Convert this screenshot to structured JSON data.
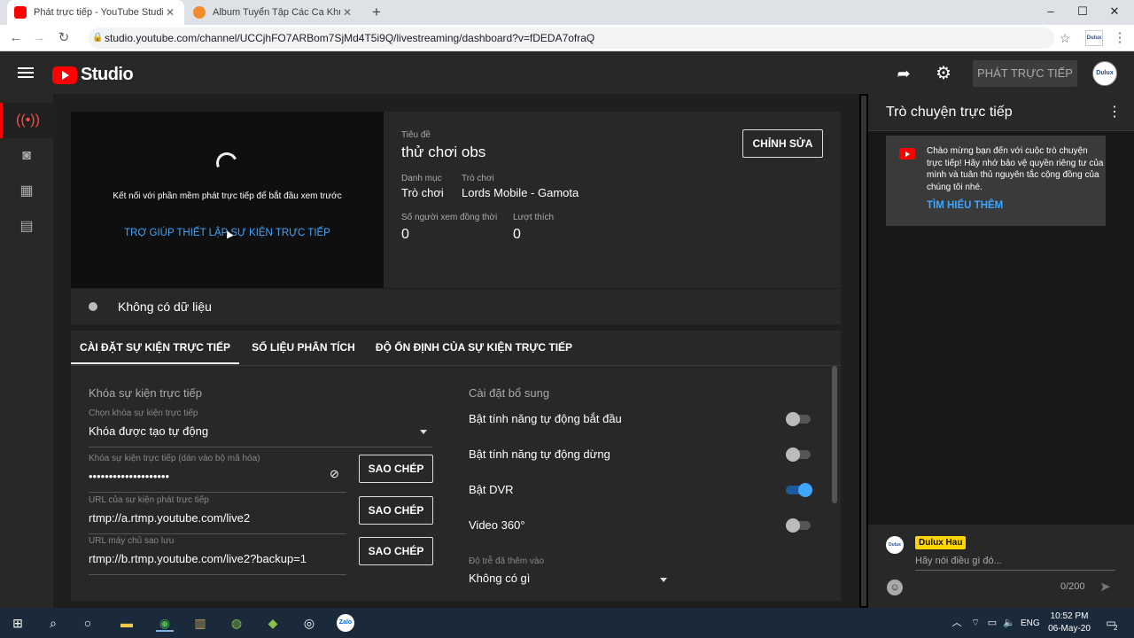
{
  "browser": {
    "tabs": [
      {
        "title": "Phát trực tiếp - YouTube Studio",
        "active": true
      },
      {
        "title": "Album Tuyển Tập Các Ca Khúc Nổ",
        "active": false
      }
    ],
    "new_tab": "+",
    "url": "studio.youtube.com/channel/UCCjhFO7ARBom7SjMd4T5i9Q/livestreaming/dashboard?v=fDEDA7ofraQ"
  },
  "header": {
    "logo_text": "Studio",
    "go_live_label": "PHÁT TRỰC TIẾP",
    "avatar_text": "Dulux"
  },
  "preview": {
    "message": "Kết nối với phần mềm phát trực tiếp để bắt đầu xem trước",
    "help_link": "TRỢ GIÚP THIẾT LẬP SỰ KIỆN TRỰC TIẾP"
  },
  "info": {
    "title_label": "Tiêu đề",
    "title_value": "thử chơi obs",
    "category_label": "Danh mục",
    "category_value": "Trò chơi",
    "game_label": "Trò chơi",
    "game_value": "Lords Mobile - Gamota",
    "viewers_label": "Số người xem đồng thời",
    "viewers_value": "0",
    "likes_label": "Lượt thích",
    "likes_value": "0",
    "edit_label": "CHỈNH SỬA"
  },
  "status": {
    "text": "Không có dữ liệu"
  },
  "settings": {
    "tabs": [
      {
        "label": "CÀI ĐẶT SỰ KIỆN TRỰC TIẾP",
        "active": true
      },
      {
        "label": "SỐ LIỆU PHÂN TÍCH",
        "active": false
      },
      {
        "label": "ĐỘ ỔN ĐỊNH CỦA SỰ KIỆN TRỰC TIẾP",
        "active": false
      }
    ],
    "stream_key_heading": "Khóa sự kiện trực tiếp",
    "select_key_label": "Chọn khóa sự kiện trực tiếp",
    "select_key_value": "Khóa được tạo tự động",
    "key_label": "Khóa sự kiện trực tiếp (dán vào bộ mã hóa)",
    "key_value": "••••••••••••••••••••",
    "url_label": "URL của sự kiện phát trực tiếp",
    "url_value": "rtmp://a.rtmp.youtube.com/live2",
    "backup_label": "URL máy chủ sao lưu",
    "backup_value": "rtmp://b.rtmp.youtube.com/live2?backup=1",
    "copy_label": "SAO CHÉP",
    "extra_heading": "Cài đặt bổ sung",
    "options": [
      {
        "label": "Bật tính năng tự động bắt đầu",
        "on": false
      },
      {
        "label": "Bật tính năng tự động dừng",
        "on": false
      },
      {
        "label": "Bật DVR",
        "on": true
      },
      {
        "label": "Video 360°",
        "on": false
      }
    ],
    "latency_label": "Độ trễ đã thêm vào",
    "latency_value": "Không có gì"
  },
  "chat": {
    "title": "Trò chuyện trực tiếp",
    "welcome_text": "Chào mừng bạn đến với cuộc trò chuyện trực tiếp! Hãy nhớ bảo vệ quyền riêng tư của mình và tuân thủ nguyên tắc cộng đồng của chúng tôi nhé.",
    "learn_more": "TÌM HIỂU THÊM",
    "user_name": "Dulux Hau",
    "input_placeholder": "Hãy nói điều gì đó...",
    "counter": "0/200"
  },
  "taskbar": {
    "language": "ENG",
    "time": "10:52 PM",
    "date": "06-May-20",
    "notification_count": "2"
  },
  "colors": {
    "accent_blue": "#3ea6ff",
    "youtube_red": "#ff0000",
    "chat_name_bg": "#ffd600"
  }
}
